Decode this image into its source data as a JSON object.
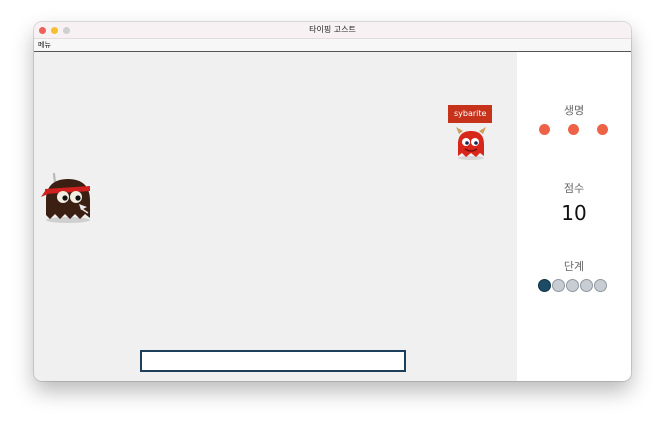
{
  "window": {
    "title": "타이핑 고스트"
  },
  "menubar": {
    "menu_label": "메뉴"
  },
  "game": {
    "ghost_word": "sybarite",
    "input_value": ""
  },
  "status": {
    "lives_label": "생명",
    "lives": 3,
    "score_label": "점수",
    "score": "10",
    "level_label": "단계",
    "level_current": 1,
    "level_total": 5
  },
  "colors": {
    "life_dot": "#ee6248",
    "level_active": "#1c4b66",
    "level_inactive": "#c7cdd3",
    "ghost_label_bg": "#c7321b",
    "input_border": "#1e3f5c"
  },
  "icons": {
    "player": "ninja-ghost-icon",
    "enemy": "red-devil-ghost-icon"
  }
}
